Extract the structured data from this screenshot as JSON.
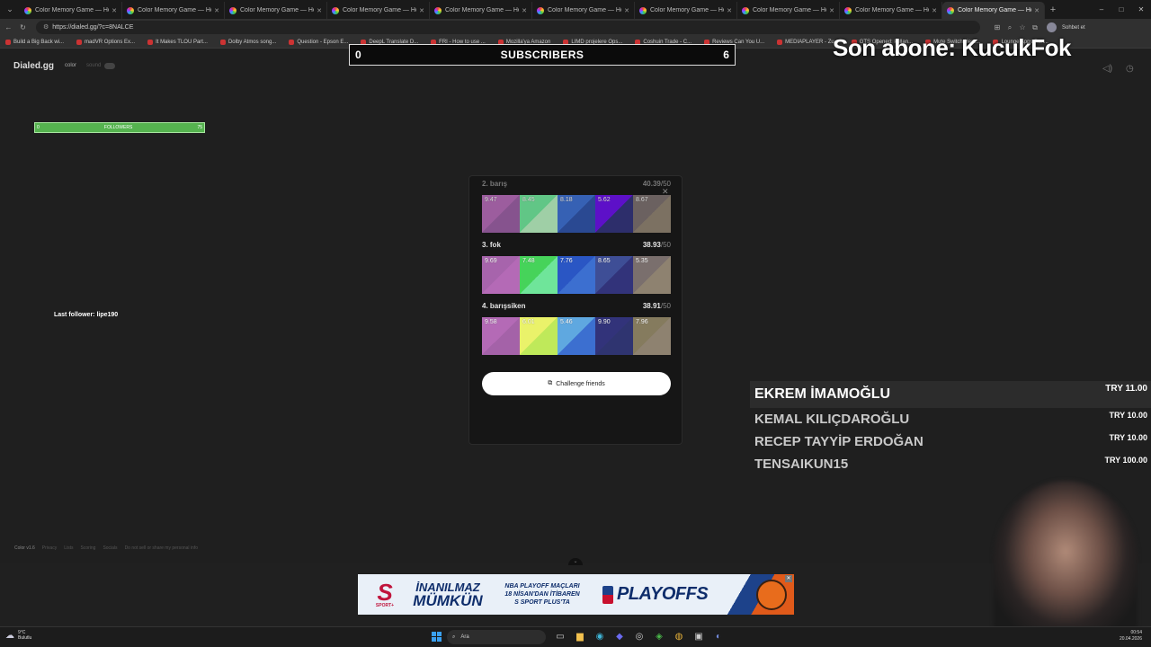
{
  "browser": {
    "tabs": [
      {
        "label": "Color Memory Game — How W"
      },
      {
        "label": "Color Memory Game — How W"
      },
      {
        "label": "Color Memory Game — How W"
      },
      {
        "label": "Color Memory Game — How W"
      },
      {
        "label": "Color Memory Game — How W"
      },
      {
        "label": "Color Memory Game — How W"
      },
      {
        "label": "Color Memory Game — How W"
      },
      {
        "label": "Color Memory Game — How W"
      },
      {
        "label": "Color Memory Game — How W"
      },
      {
        "label": "Color Memory Game — How W"
      }
    ],
    "url": "https://dialed.gg/?c=8NALCE",
    "bookmarks": [
      "Build a Big Back wi...",
      "madVR Options Ex...",
      "It Makes TLOU Part...",
      "Dolby Atmos song...",
      "Question - Epson E...",
      "DeepL Translate D...",
      "FRI - How to use ...",
      "Mozilla'ya Amazon",
      "LIMD projelere Ops...",
      "Coshuin Trade - C...",
      "Reviews Can You U...",
      "MEDIAPLAYER - Zu...",
      "GTS Opened: kullan...",
      "Mute Switch Here...",
      "Lounge Apps Ban..."
    ],
    "gemini_label": "Sohbet et"
  },
  "page": {
    "brand": "Dialed.gg",
    "mode": "color",
    "sound": "sound",
    "footer": [
      "Color v1.6",
      "Privacy",
      "Lists",
      "Scoring",
      "Socials",
      "Do not sell or share my personal info"
    ]
  },
  "results": {
    "players": [
      {
        "rank_name": "2. barış",
        "score": "40.39",
        "max": "/50",
        "faded": true,
        "swatches": [
          {
            "value": "9.47",
            "a": "#b46ab6",
            "b": "#9a5ea4"
          },
          {
            "value": "8.45",
            "a": "#6fe59a",
            "b": "#b7f0c0"
          },
          {
            "value": "8.18",
            "a": "#3c6fd0",
            "b": "#2e52a8"
          },
          {
            "value": "5.62",
            "a": "#6a10e8",
            "b": "#32337a"
          },
          {
            "value": "8.67",
            "a": "#7a6f6d",
            "b": "#8e8270"
          }
        ]
      },
      {
        "rank_name": "3. fok",
        "score": "38.93",
        "max": "/50",
        "faded": false,
        "swatches": [
          {
            "value": "9.69",
            "a": "#a764ac",
            "b": "#b46ab6"
          },
          {
            "value": "7.48",
            "a": "#46d35a",
            "b": "#6fe59a"
          },
          {
            "value": "7.76",
            "a": "#2a56c4",
            "b": "#3c6fd0"
          },
          {
            "value": "8.65",
            "a": "#3e4e96",
            "b": "#32337a"
          },
          {
            "value": "5.35",
            "a": "#7a6f6d",
            "b": "#8e8270"
          }
        ]
      },
      {
        "rank_name": "4. barışsiken",
        "score": "38.91",
        "max": "/50",
        "faded": false,
        "swatches": [
          {
            "value": "9.58",
            "a": "#b46ab6",
            "b": "#a462a8"
          },
          {
            "value": "6.01",
            "a": "#eaf26a",
            "b": "#bfe95a"
          },
          {
            "value": "5.46",
            "a": "#5fa8e0",
            "b": "#3c6fd0"
          },
          {
            "value": "9.90",
            "a": "#32337a",
            "b": "#2f3470"
          },
          {
            "value": "7.96",
            "a": "#857b5e",
            "b": "#8e8270"
          }
        ]
      }
    ],
    "challenge_label": "Challenge friends"
  },
  "overlays": {
    "subscribers": {
      "left": "0",
      "title": "SUBSCRIBERS",
      "right": "6"
    },
    "last_sub": "Son abone: KucukFok",
    "followers": {
      "left": "0",
      "label": "FOLLOWERS",
      "right": "75"
    },
    "last_follower": "Last follower: lipe190",
    "donations": [
      {
        "name": "EKREM İMAMOĞLU",
        "amount": "TRY 11.00"
      },
      {
        "name": "KEMAL KILIÇDAROĞLU",
        "amount": "TRY 10.00"
      },
      {
        "name": "RECEP TAYYİP ERDOĞAN",
        "amount": "TRY 10.00"
      },
      {
        "name": "TENSAIKUN15",
        "amount": "TRY 100.00"
      }
    ]
  },
  "ad": {
    "slogan1": "İNANILMAZ",
    "slogan2": "MÜMKÜN",
    "line1": "NBA PLAYOFF MAÇLARI",
    "line2": "18 NİSAN'DAN İTİBAREN",
    "line3": "S SPORT PLUS'TA",
    "playoffs": "PLAYOFFS",
    "brand": "S",
    "brand_sub": "SPORT+"
  },
  "taskbar": {
    "temp": "9°C",
    "weather": "Bulutlu",
    "search": "Ara",
    "time": "00:54",
    "date": "20.04.2026"
  }
}
